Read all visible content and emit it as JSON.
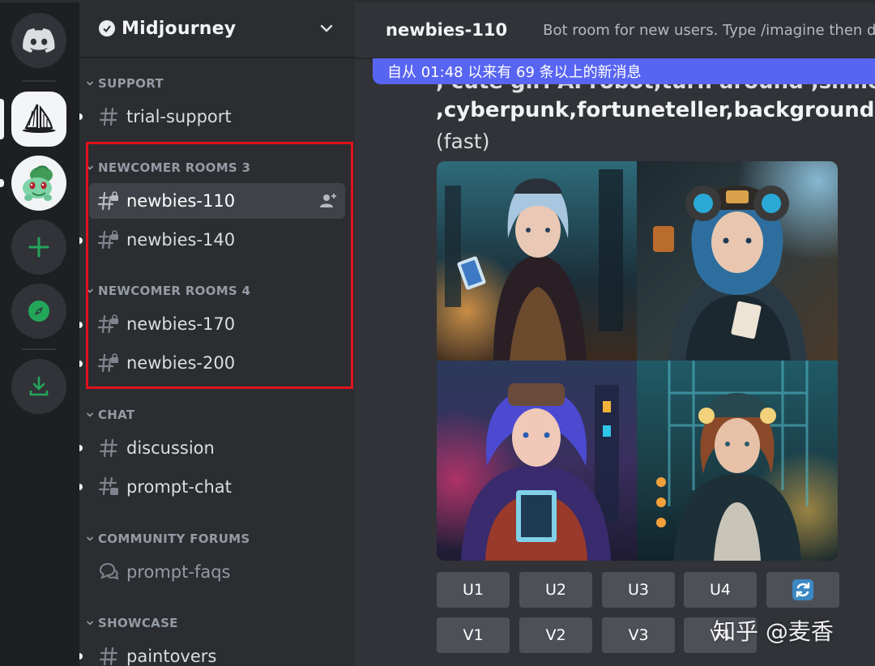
{
  "server": {
    "name": "Midjourney"
  },
  "categories": {
    "support": "SUPPORT",
    "newcomer3": "NEWCOMER ROOMS 3",
    "newcomer4": "NEWCOMER ROOMS 4",
    "chat": "CHAT",
    "community_forums": "COMMUNITY FORUMS",
    "showcase": "SHOWCASE"
  },
  "channels": {
    "trial_support": "trial-support",
    "newbies_110": "newbies-110",
    "newbies_140": "newbies-140",
    "newbies_170": "newbies-170",
    "newbies_200": "newbies-200",
    "discussion": "discussion",
    "prompt_chat": "prompt-chat",
    "prompt_faqs": "prompt-faqs",
    "paintovers": "paintovers"
  },
  "channel_header": {
    "name": "newbies-110",
    "topic": "Bot room for new users. Type /imagine then desc"
  },
  "new_messages_bar": "自从 01:48 以来有 69 条以上的新消息",
  "message": {
    "prompt_line_1": ", cute girl AI robot,turn around ,smile ,super",
    "prompt_line_2": ",cyberpunk,fortuneteller,background is a fu",
    "mode": "(fast)"
  },
  "buttons": {
    "u1": "U1",
    "u2": "U2",
    "u3": "U3",
    "u4": "U4",
    "v1": "V1",
    "v2": "V2",
    "v3": "V3",
    "v4": "V4"
  },
  "watermark": "知乎 @麦香",
  "colors": {
    "blurple": "#5865f2",
    "highlight_red": "#e0121b",
    "discord_green": "#23a55a"
  },
  "icons": {
    "home": "discord-logo-icon",
    "midjourney": "sailboat-icon",
    "bulbasaur": "avatar-icon",
    "add": "plus-icon",
    "explore": "compass-icon",
    "download": "download-icon",
    "reroll": "refresh-icon"
  }
}
